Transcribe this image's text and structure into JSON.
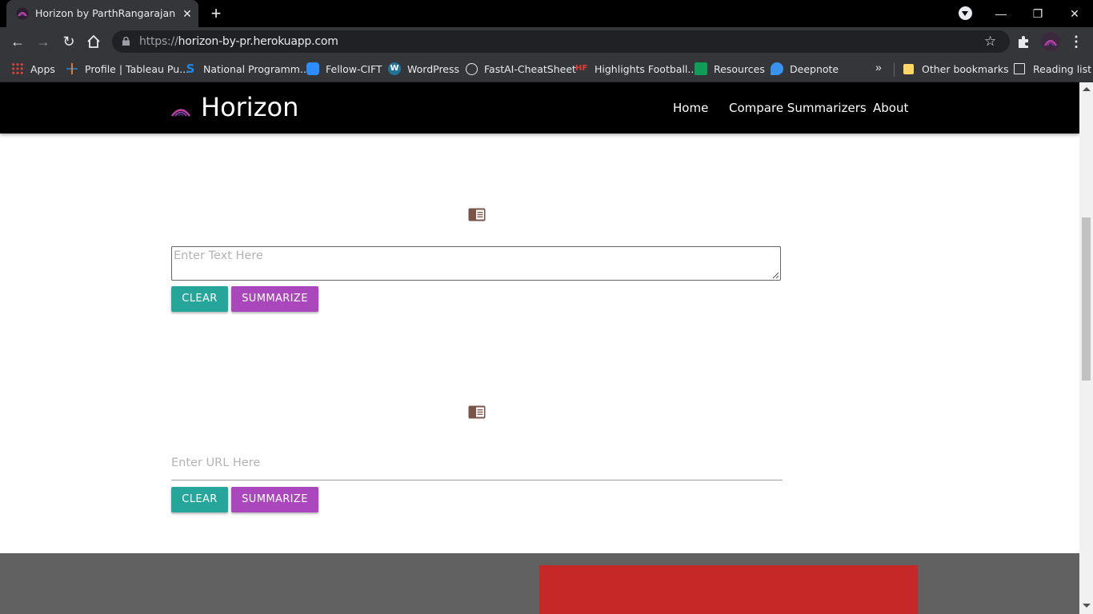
{
  "browser": {
    "tab_title": "Horizon by ParthRangarajan",
    "tab_close": "✕",
    "new_tab": "+",
    "url_scheme": "https://",
    "url_host": "horizon-by-pr.herokuapp.com",
    "window_controls": {
      "minimize": "—",
      "restore": "❐",
      "close": "✕"
    },
    "more_bookmarks": "»",
    "bookmarks": [
      {
        "label": "Apps",
        "icon": "apps-grid-icon"
      },
      {
        "label": "Profile | Tableau Pu...",
        "icon": "tableau-icon"
      },
      {
        "label": "National Programm...",
        "icon": "swayam-icon"
      },
      {
        "label": "Fellow-CIFT",
        "icon": "zoom-icon"
      },
      {
        "label": "WordPress",
        "icon": "wordpress-icon"
      },
      {
        "label": "FastAI-CheatSheet",
        "icon": "globe-icon"
      },
      {
        "label": "Highlights Football...",
        "icon": "hf-icon"
      },
      {
        "label": "Resources",
        "icon": "sheets-icon"
      },
      {
        "label": "Deepnote",
        "icon": "deepnote-icon"
      }
    ],
    "other_bookmarks": "Other bookmarks",
    "reading_list": "Reading list"
  },
  "site": {
    "brand": "Horizon",
    "nav": {
      "home": "Home",
      "compare": "Compare Summarizers",
      "about": "About"
    }
  },
  "text_section": {
    "icon": "reader-icon",
    "placeholder": "Enter Text Here",
    "clear_label": "CLEAR",
    "summarize_label": "SUMMARIZE"
  },
  "url_section": {
    "icon": "reader-icon",
    "placeholder": "Enter URL Here",
    "clear_label": "CLEAR",
    "summarize_label": "SUMMARIZE"
  },
  "colors": {
    "clear_button": "#26a69a",
    "summarize_button": "#ab47bc",
    "footer_band": "#616161",
    "red_panel": "#c62828"
  }
}
